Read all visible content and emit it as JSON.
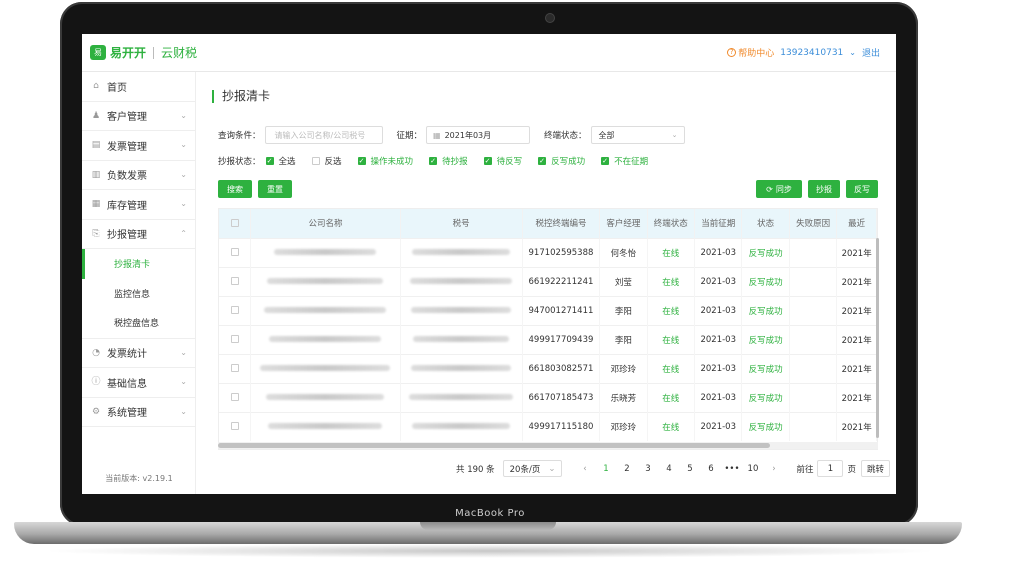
{
  "device": {
    "label": "MacBook Pro"
  },
  "header": {
    "logo_mark": "易",
    "logo_text": "易开开",
    "logo_sub": "云财税",
    "help_label": "帮助中心",
    "phone": "13923410731",
    "logout": "退出"
  },
  "sidebar": {
    "items": [
      {
        "label": "首页",
        "icon": "home-icon",
        "glyph": "⌂",
        "arrow": ""
      },
      {
        "label": "客户管理",
        "icon": "user-icon",
        "glyph": "♟",
        "arrow": "⌄"
      },
      {
        "label": "发票管理",
        "icon": "invoice-icon",
        "glyph": "▤",
        "arrow": "⌄"
      },
      {
        "label": "负数发票",
        "icon": "negative-invoice-icon",
        "glyph": "▥",
        "arrow": "⌄"
      },
      {
        "label": "库存管理",
        "icon": "inventory-icon",
        "glyph": "▦",
        "arrow": "⌄"
      },
      {
        "label": "抄报管理",
        "icon": "report-icon",
        "glyph": "⎘",
        "arrow": "⌃"
      }
    ],
    "sub_items": [
      {
        "label": "抄报清卡",
        "active": true
      },
      {
        "label": "监控信息",
        "active": false
      },
      {
        "label": "税控盘信息",
        "active": false
      }
    ],
    "items_after": [
      {
        "label": "发票统计",
        "icon": "stats-icon",
        "glyph": "◔",
        "arrow": "⌄"
      },
      {
        "label": "基础信息",
        "icon": "info-icon",
        "glyph": "ⓘ",
        "arrow": "⌄"
      },
      {
        "label": "系统管理",
        "icon": "settings-icon",
        "glyph": "⚙",
        "arrow": "⌄"
      }
    ],
    "version": "当前版本: v2.19.1"
  },
  "main": {
    "title": "抄报清卡",
    "filters": {
      "query_label": "查询条件：",
      "query_placeholder": "请输入公司名称/公司税号",
      "period_label": "征期：",
      "period_value": "2021年03月",
      "terminal_label": "终端状态：",
      "terminal_value": "全部"
    },
    "report_status": {
      "label": "抄报状态：",
      "options": [
        {
          "label": "全选",
          "checked": true
        },
        {
          "label": "反选",
          "checked": false
        },
        {
          "label": "操作未成功",
          "checked": true
        },
        {
          "label": "待抄报",
          "checked": true
        },
        {
          "label": "待反写",
          "checked": true
        },
        {
          "label": "反写成功",
          "checked": true
        },
        {
          "label": "不在征期",
          "checked": true
        }
      ]
    },
    "buttons": {
      "search": "搜索",
      "reset": "重置",
      "sync": "同步",
      "report": "抄报",
      "writeback": "反写"
    },
    "table": {
      "columns": [
        "公司名称",
        "税号",
        "税控终端编号",
        "客户经理",
        "终端状态",
        "当前征期",
        "状态",
        "失败原因",
        "最近"
      ],
      "rows": [
        {
          "terminal": "917102595388",
          "manager": "何冬怡",
          "status": "在线",
          "period": "2021-03",
          "state": "反写成功",
          "reason": "",
          "recent": "2021年"
        },
        {
          "terminal": "661922211241",
          "manager": "刘莹",
          "status": "在线",
          "period": "2021-03",
          "state": "反写成功",
          "reason": "",
          "recent": "2021年"
        },
        {
          "terminal": "947001271411",
          "manager": "李阳",
          "status": "在线",
          "period": "2021-03",
          "state": "反写成功",
          "reason": "",
          "recent": "2021年"
        },
        {
          "terminal": "499917709439",
          "manager": "李阳",
          "status": "在线",
          "period": "2021-03",
          "state": "反写成功",
          "reason": "",
          "recent": "2021年"
        },
        {
          "terminal": "661803082571",
          "manager": "邓珍玲",
          "status": "在线",
          "period": "2021-03",
          "state": "反写成功",
          "reason": "",
          "recent": "2021年"
        },
        {
          "terminal": "661707185473",
          "manager": "乐晓芳",
          "status": "在线",
          "period": "2021-03",
          "state": "反写成功",
          "reason": "",
          "recent": "2021年"
        },
        {
          "terminal": "499917115180",
          "manager": "邓珍玲",
          "status": "在线",
          "period": "2021-03",
          "state": "反写成功",
          "reason": "",
          "recent": "2021年"
        }
      ]
    },
    "pagination": {
      "total": "共 190 条",
      "page_size": "20条/页",
      "pages": [
        "1",
        "2",
        "3",
        "4",
        "5",
        "6",
        "•••",
        "10"
      ],
      "current": "1",
      "goto_label": "前往",
      "goto_value": "1",
      "page_unit": "页",
      "jump": "跳转"
    }
  }
}
